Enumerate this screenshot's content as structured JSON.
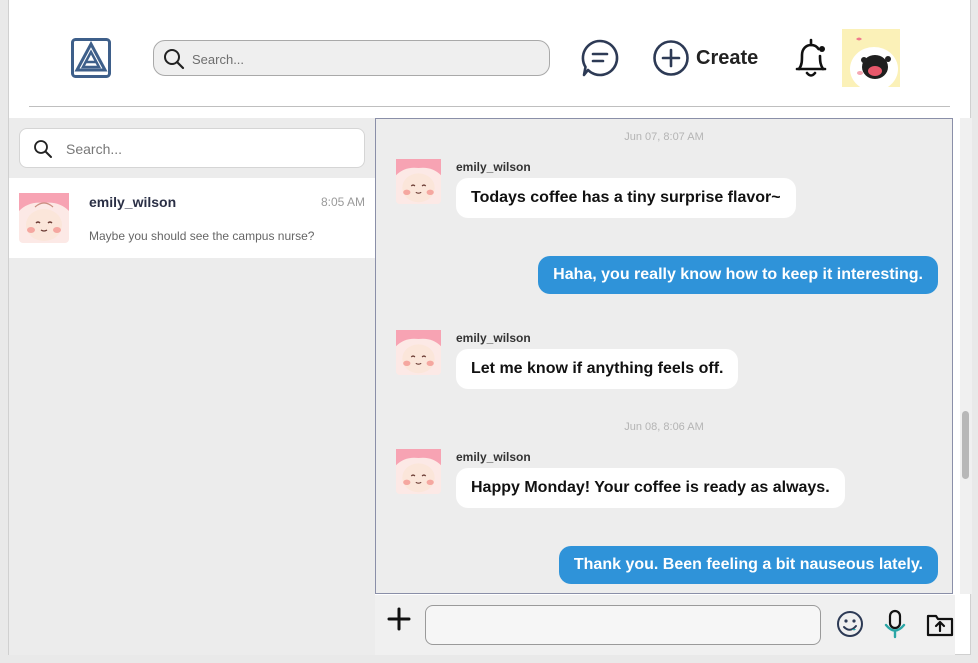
{
  "header": {
    "search_placeholder": "Search...",
    "create_label": "Create"
  },
  "sidebar": {
    "search_placeholder": "Search...",
    "conversations": [
      {
        "name": "emily_wilson",
        "time": "8:05 AM",
        "preview": "Maybe you should see the campus nurse?"
      }
    ]
  },
  "chat": {
    "stamps": [
      "Jun 07, 8:07 AM",
      "Jun 08, 8:06 AM"
    ],
    "messages": [
      {
        "direction": "in",
        "sender": "emily_wilson",
        "text": "Todays coffee has a tiny surprise flavor~"
      },
      {
        "direction": "out",
        "text": "Haha, you really know how to keep it interesting."
      },
      {
        "direction": "in",
        "sender": "emily_wilson",
        "text": "Let me know if anything feels off."
      },
      {
        "direction": "in",
        "sender": "emily_wilson",
        "text": "Happy Monday! Your coffee is ready as always."
      },
      {
        "direction": "out",
        "text": "Thank you. Been feeling a bit nauseous lately."
      }
    ]
  },
  "composer": {
    "placeholder": ""
  },
  "colors": {
    "outgoing_bubble": "#2f93d9",
    "logo": "#3e5f8a",
    "accent_mic": "#2aa6a6"
  },
  "icons": [
    "app-logo-icon",
    "search-icon",
    "chat-icon",
    "plus-circle-icon",
    "bell-icon",
    "plus-icon",
    "emoji-icon",
    "mic-icon",
    "upload-icon"
  ]
}
